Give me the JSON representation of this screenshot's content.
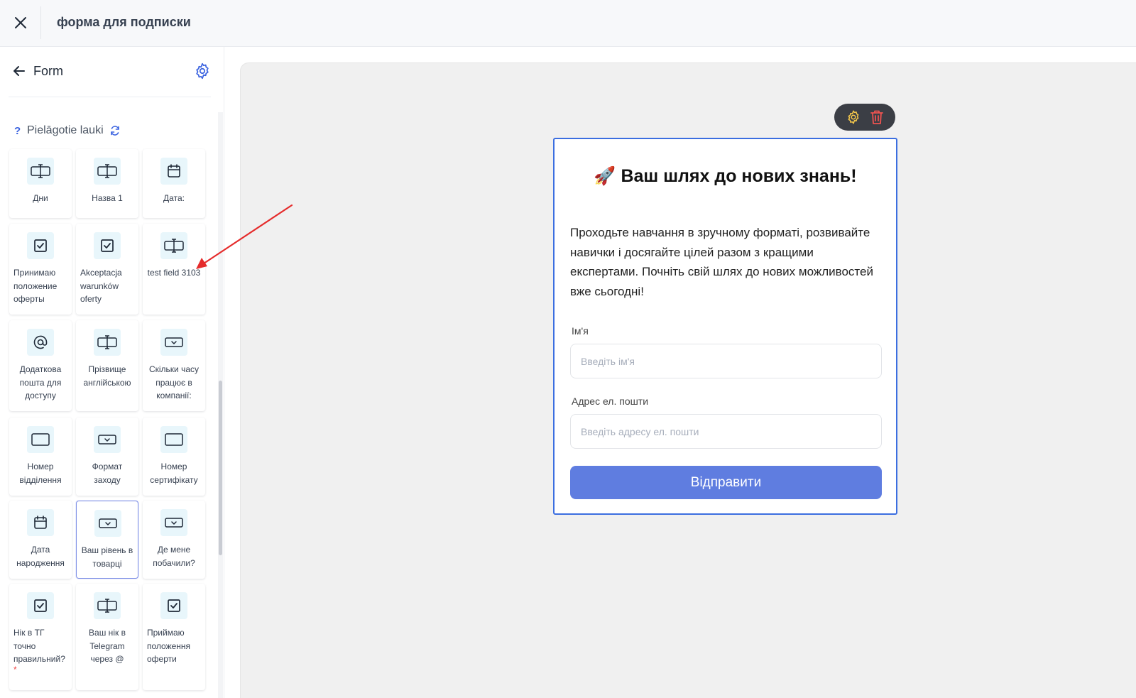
{
  "topbar": {
    "title": "форма для подписки"
  },
  "sidebar": {
    "title": "Form",
    "section_label": "Pielāgotie lauki",
    "tiles": [
      {
        "label": "Дни",
        "icon": "text-field-icon"
      },
      {
        "label": "Назва 1",
        "icon": "text-field-icon"
      },
      {
        "label": "Дата:",
        "icon": "calendar-icon"
      },
      {
        "label": "Принимаю положение оферты",
        "icon": "checkbox-icon"
      },
      {
        "label": "Akceptacja warunków oferty",
        "icon": "checkbox-icon"
      },
      {
        "label": "test field 3103",
        "icon": "text-field-icon"
      },
      {
        "label": "Додаткова пошта для доступу",
        "icon": "at-sign-icon"
      },
      {
        "label": "Прізвище англійською",
        "icon": "text-field-icon"
      },
      {
        "label": "Скільки часу працює в компанії:",
        "icon": "dropdown-icon"
      },
      {
        "label": "Номер відділення",
        "icon": "input-box-icon"
      },
      {
        "label": "Формат заходу",
        "icon": "dropdown-icon"
      },
      {
        "label": "Номер сертифікату",
        "icon": "input-box-icon"
      },
      {
        "label": "Дата народження",
        "icon": "calendar-icon"
      },
      {
        "label": "Ваш рівень в товарці",
        "icon": "dropdown-icon"
      },
      {
        "label": "Де мене побачили?",
        "icon": "dropdown-icon"
      },
      {
        "label": "Нік в ТГ точно правильний?",
        "icon": "checkbox-icon",
        "required": "*"
      },
      {
        "label": "Ваш нік в Telegram через @",
        "icon": "text-field-icon"
      },
      {
        "label": "Приймаю положення оферти",
        "icon": "checkbox-icon"
      }
    ]
  },
  "form": {
    "title": "🚀 Ваш шлях до нових знань!",
    "description": "Проходьте навчання в зручному форматі, розвивайте навички і досягайте цілей разом з кращими експертами. Почніть свій шлях до нових можливостей вже сьогодні!",
    "fields": [
      {
        "label": "Ім'я",
        "placeholder": "Введіть ім'я"
      },
      {
        "label": "Адрес ел. пошти",
        "placeholder": "Введіть адресу ел. пошти"
      }
    ],
    "submit_label": "Відправити"
  },
  "colors": {
    "accent": "#3b6ee0",
    "submit": "#5f7de0",
    "toolbar_bg": "#3b3e45",
    "gear_yellow": "#f5c84b",
    "trash_red": "#ef5350",
    "arrow_red": "#e52b2b"
  }
}
